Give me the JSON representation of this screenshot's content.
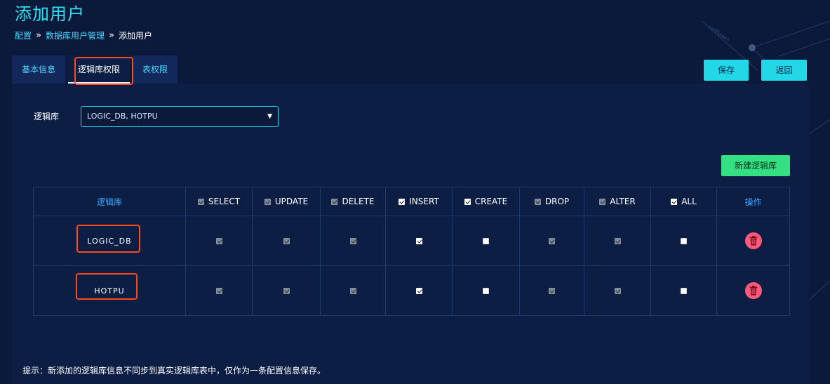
{
  "page": {
    "title": "添加用户"
  },
  "breadcrumb": [
    {
      "label": "配置"
    },
    {
      "label": "数据库用户管理"
    },
    {
      "label": "添加用户"
    }
  ],
  "tabs": [
    {
      "label": "基本信息"
    },
    {
      "label": "逻辑库权限",
      "active": true
    },
    {
      "label": "表权限"
    }
  ],
  "actions": {
    "save": "保存",
    "back": "返回",
    "new_logic_db": "新建逻辑库"
  },
  "form": {
    "logic_db_label": "逻辑库",
    "logic_db_value": "LOGIC_DB, HOTPU"
  },
  "table": {
    "headers": [
      "逻辑库",
      "SELECT",
      "UPDATE",
      "DELETE",
      "INSERT",
      "CREATE",
      "DROP",
      "ALTER",
      "ALL",
      "操作"
    ],
    "header_checks": [
      "disabled-checked",
      "disabled-checked",
      "disabled-checked",
      "checked",
      "checked",
      "disabled-checked",
      "disabled-checked",
      "checked"
    ],
    "rows": [
      {
        "name": "LOGIC_DB",
        "perms": [
          "disabled-checked",
          "disabled-checked",
          "disabled-checked",
          "checked",
          "unchecked",
          "disabled-checked",
          "disabled-checked",
          "unchecked"
        ]
      },
      {
        "name": "HOTPU",
        "perms": [
          "disabled-checked",
          "disabled-checked",
          "disabled-checked",
          "checked",
          "unchecked",
          "disabled-checked",
          "disabled-checked",
          "unchecked"
        ]
      }
    ]
  },
  "hint": "提示：新添加的逻辑库信息不同步到真实逻辑库表中，仅作为一条配置信息保存。",
  "colors": {
    "accent": "#23d8e6",
    "success": "#34e082",
    "danger": "#ff5a7a",
    "highlight": "#ff4a1c",
    "background": "#0b1a3a"
  },
  "icons": {
    "breadcrumb_separator": "double-chevron-right-icon",
    "delete": "trash-icon",
    "dropdown": "caret-down-icon"
  }
}
